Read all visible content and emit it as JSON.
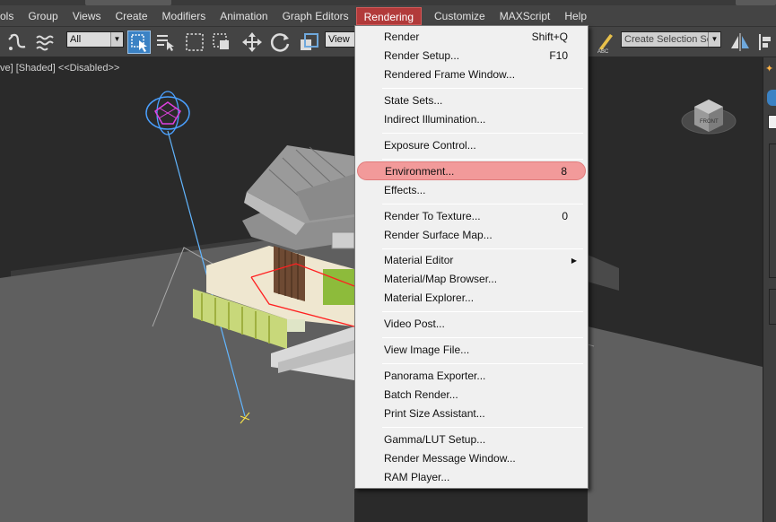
{
  "menubar": {
    "items": [
      {
        "label": "ols"
      },
      {
        "label": "Group"
      },
      {
        "label": "Views"
      },
      {
        "label": "Create"
      },
      {
        "label": "Modifiers"
      },
      {
        "label": "Animation"
      },
      {
        "label": "Graph Editors"
      },
      {
        "label": "Rendering",
        "active": true
      },
      {
        "label": "Customize"
      },
      {
        "label": "MAXScript"
      },
      {
        "label": "Help"
      }
    ]
  },
  "toolbar": {
    "selection_filter": "All",
    "reference_coord": "View",
    "named_selection_placeholder": "Create Selection Se"
  },
  "viewport": {
    "label": "ve] [Shaded]  <<Disabled>>"
  },
  "rendering_menu": {
    "items": [
      {
        "label": "Render",
        "shortcut": "Shift+Q"
      },
      {
        "label": "Render Setup...",
        "shortcut": "F10"
      },
      {
        "label": "Rendered Frame Window...",
        "shortcut": ""
      },
      {
        "label": "State Sets...",
        "shortcut": ""
      },
      {
        "label": "Indirect Illumination...",
        "shortcut": ""
      },
      {
        "label": "Exposure Control...",
        "shortcut": ""
      },
      {
        "label": "Environment...",
        "shortcut": "8",
        "highlighted": true
      },
      {
        "label": "Effects...",
        "shortcut": ""
      },
      {
        "label": "Render To Texture...",
        "shortcut": "0"
      },
      {
        "label": "Render Surface Map...",
        "shortcut": ""
      },
      {
        "label": "Material Editor",
        "shortcut": "",
        "submenu": true
      },
      {
        "label": "Material/Map Browser...",
        "shortcut": ""
      },
      {
        "label": "Material Explorer...",
        "shortcut": ""
      },
      {
        "label": "Video Post...",
        "shortcut": ""
      },
      {
        "label": "View Image File...",
        "shortcut": ""
      },
      {
        "label": "Panorama Exporter...",
        "shortcut": ""
      },
      {
        "label": "Batch Render...",
        "shortcut": ""
      },
      {
        "label": "Print Size Assistant...",
        "shortcut": ""
      },
      {
        "label": "Gamma/LUT Setup...",
        "shortcut": ""
      },
      {
        "label": "Render Message Window...",
        "shortcut": ""
      },
      {
        "label": "RAM Player...",
        "shortcut": ""
      }
    ]
  },
  "colors": {
    "menu_highlight": "#f29a9a",
    "active_menu": "#b23a3a",
    "ui_dark": "#444444",
    "viewport_bg": "#2a2a2a"
  }
}
